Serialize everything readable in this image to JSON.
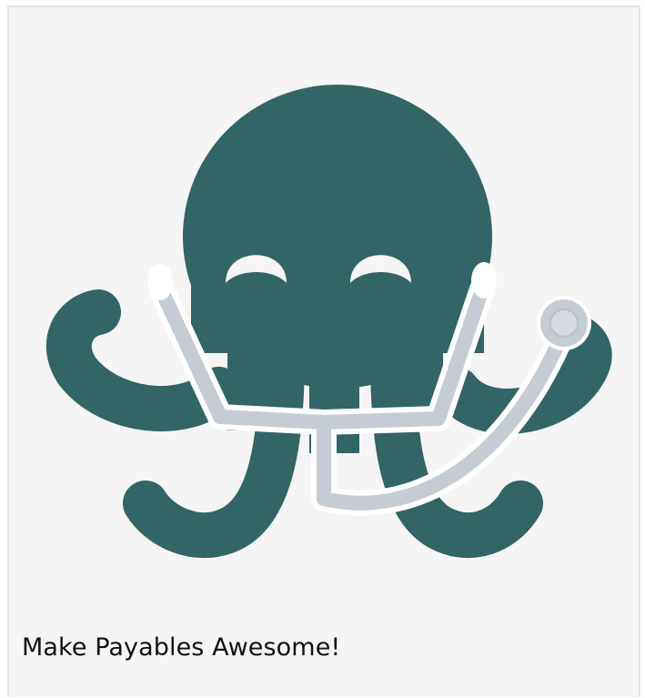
{
  "card": {
    "caption": "Make Payables Awesome!"
  },
  "logo": {
    "icon": "octopus-with-stethoscope-icon",
    "colors": {
      "body": "#326565",
      "stethoscope": "#c6ccd4",
      "stethoscope_outline": "#ffffff",
      "background": "#f5f5f5"
    }
  }
}
